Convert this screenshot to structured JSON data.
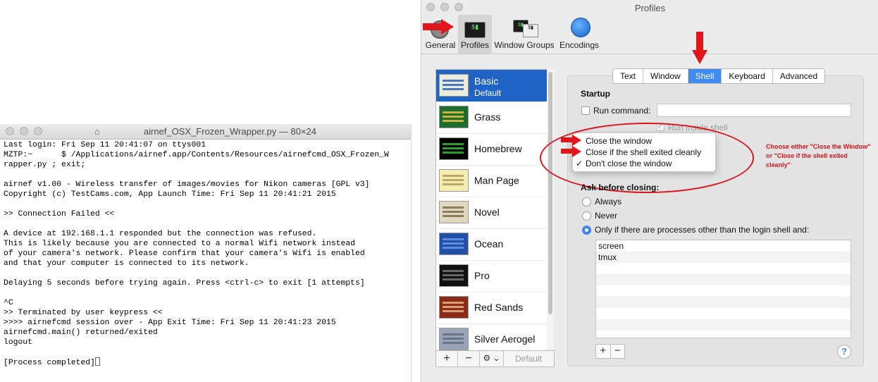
{
  "terminal": {
    "title": "airnef_OSX_Frozen_Wrapper.py — 80×24",
    "lines": [
      "Last login: Fri Sep 11 20:41:07 on ttys001",
      "MZTP:~      $ /Applications/airnef.app/Contents/Resources/airnefcmd_OSX_Frozen_W",
      "rapper.py ; exit;",
      "",
      "airnef v1.00 - Wireless transfer of images/movies for Nikon cameras [GPL v3]",
      "Copyright (c) TestCams.com, App Launch Time: Fri Sep 11 20:41:21 2015",
      "",
      ">> Connection Failed <<",
      "",
      "A device at 192.168.1.1 responded but the connection was refused.",
      "This is likely because you are connected to a normal Wifi network instead",
      "of your camera's network. Please confirm that your camera's Wifi is enabled",
      "and that your computer is connected to its network.",
      "",
      "Delaying 5 seconds before trying again. Press <ctrl-c> to exit [1 attempts]",
      "",
      "^C",
      ">> Terminated by user keypress <<",
      ">>>> airnefcmd session over - App Exit Time: Fri Sep 11 20:41:23 2015",
      "airnefcmd.main() returned/exited",
      "logout",
      "",
      "[Process completed]"
    ]
  },
  "prefs": {
    "title": "Profiles",
    "toolbar": [
      "General",
      "Profiles",
      "Window Groups",
      "Encodings"
    ],
    "profiles": [
      {
        "name": "Basic",
        "sub": "Default",
        "bg": "#ececdc",
        "bar": "#4a78c0"
      },
      {
        "name": "Grass",
        "sub": "",
        "bg": "#1d6b2e",
        "bar": "#c9b23a"
      },
      {
        "name": "Homebrew",
        "sub": "",
        "bg": "#000000",
        "bar": "#2a9d2a"
      },
      {
        "name": "Man Page",
        "sub": "",
        "bg": "#f6eeb0",
        "bar": "#b8a86a"
      },
      {
        "name": "Novel",
        "sub": "",
        "bg": "#e0d8c0",
        "bar": "#8c7a5c"
      },
      {
        "name": "Ocean",
        "sub": "",
        "bg": "#2250a8",
        "bar": "#5c8ee0"
      },
      {
        "name": "Pro",
        "sub": "",
        "bg": "#111111",
        "bar": "#666666"
      },
      {
        "name": "Red Sands",
        "sub": "",
        "bg": "#8c2a1a",
        "bar": "#d8a070"
      },
      {
        "name": "Silver Aerogel",
        "sub": "",
        "bg": "#9aa4b8",
        "bar": "#6a7488"
      }
    ],
    "list_buttons": {
      "add": "+",
      "remove": "−",
      "gear": "⚙ ⌄",
      "default": "Default"
    },
    "tabs": [
      "Text",
      "Window",
      "Shell",
      "Keyboard",
      "Advanced"
    ],
    "active_tab": "Shell",
    "startup": {
      "heading": "Startup",
      "run_command": "Run command:",
      "run_inside_shell": "Run inside shell"
    },
    "when_shell_exits": {
      "options": [
        "Close the window",
        "Close if the shell exited cleanly",
        "Don't close the window"
      ],
      "checked": "✓"
    },
    "ask": {
      "heading": "Ask before closing:",
      "options": [
        "Always",
        "Never",
        "Only if there are processes other than the login shell and:"
      ],
      "selected": 2
    },
    "processes": [
      "screen",
      "tmux"
    ],
    "proc_buttons": {
      "add": "+",
      "remove": "−"
    },
    "help": "?"
  },
  "annotation": {
    "note": "Choose either \"Close the Window\" or \"Close if the shell exited cleanly\"",
    "color": "#d8151b"
  }
}
